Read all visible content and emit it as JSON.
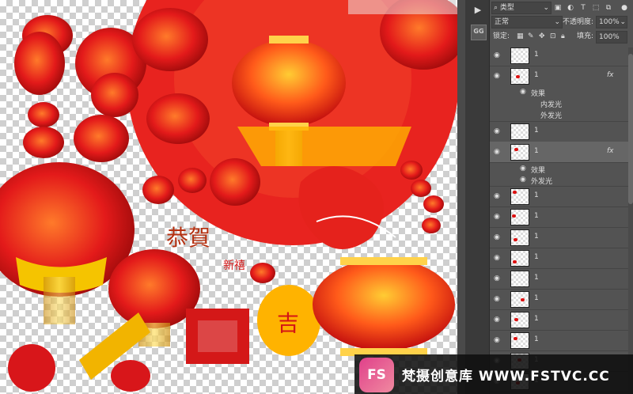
{
  "canvas": {
    "label": "Lantern collage canvas"
  },
  "toolstrip": {
    "play_icon": "play-icon",
    "gg_label": "GG"
  },
  "panel": {
    "kind_label": "类型",
    "blend_mode": "正常",
    "opacity_label": "不透明度:",
    "opacity_value": "100%",
    "lock_label": "锁定:",
    "fill_label": "填充:",
    "fill_value": "100%",
    "fx_label": "fx",
    "effects_label": "效果",
    "inner_glow": "内发光",
    "outer_glow": "外发光"
  },
  "layers": [
    {
      "name": "1",
      "fx": false
    },
    {
      "name": "1",
      "fx": true
    },
    {
      "name": "1",
      "fx": false
    },
    {
      "name": "1",
      "fx": true
    },
    {
      "name": "1",
      "fx": false
    },
    {
      "name": "1",
      "fx": false
    },
    {
      "name": "1",
      "fx": false
    },
    {
      "name": "1",
      "fx": false
    },
    {
      "name": "1",
      "fx": false
    },
    {
      "name": "1",
      "fx": false
    },
    {
      "name": "1",
      "fx": false
    },
    {
      "name": "1",
      "fx": false
    },
    {
      "name": "1",
      "fx": false
    },
    {
      "name": "1",
      "fx": false
    }
  ],
  "watermark": {
    "logo": "FS",
    "text": "梵摄创意库 WWW.FSTVC.CC"
  }
}
